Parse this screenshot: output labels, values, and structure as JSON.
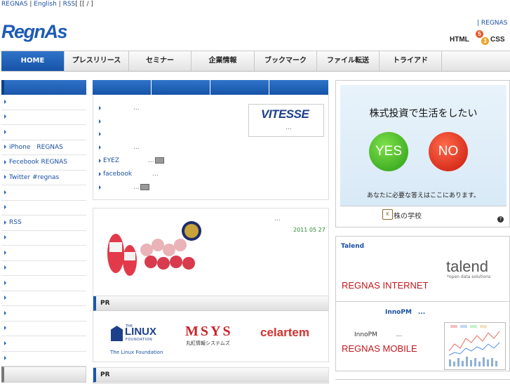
{
  "topbar": {
    "regnas": "REGNAS",
    "english": "English",
    "rss": "RSS",
    "tail": "[    [[     /  ]"
  },
  "logo": {
    "text": "RegnAs"
  },
  "header_right": {
    "link": "| REGNAS",
    "badge_left": "HTML",
    "badge_right": "CSS",
    "badge_5": "5",
    "badge_3": "3"
  },
  "nav": {
    "items": [
      "HOME",
      "プレスリリース",
      "セミナー",
      "企業情報",
      "ブックマーク",
      "ファイル転送",
      "トライアド"
    ]
  },
  "left_list": {
    "items": [
      "",
      "",
      "",
      "iPhone　REGNAS",
      "Fecebook REGNAS",
      "Twitter #regnas",
      "",
      "",
      "RSS",
      "",
      "",
      "",
      "",
      "",
      "",
      "",
      "",
      ""
    ]
  },
  "news": {
    "items": [
      {
        "text": "",
        "dots": "..."
      },
      {
        "text": "",
        "dots": ""
      },
      {
        "text": "",
        "dots": ""
      },
      {
        "text": "",
        "dots": "..."
      },
      {
        "text": "EYEZ",
        "dots": "..."
      },
      {
        "text": "facebook",
        "dots": "..."
      },
      {
        "text": "",
        "dots": "..."
      }
    ],
    "vitesse": {
      "logo": "VITESSE",
      "dots": "..."
    }
  },
  "featured": {
    "dots": "...",
    "date": "2011 05 27"
  },
  "pr": {
    "header": "PR",
    "linux_the": "THE",
    "linux_name": "LINUX",
    "linux_foundation": "FOUNDATION",
    "linux_caption": "The Linux Foundation",
    "msys": "MSYS",
    "msys_sub": "丸紅情報システムズ",
    "celartem": "celartem"
  },
  "pr2": {
    "header": "PR"
  },
  "ad": {
    "title": "株式投資で生活をしたい",
    "yes": "YES",
    "no": "NO",
    "sub": "あなたに必要な答えはここにあります。",
    "school": "株の学校",
    "school_icon": "K",
    "qmark": "?"
  },
  "talend": {
    "header": "Talend",
    "logo": "talend",
    "logo_sub": "*open data solutions",
    "big": "REGNAS INTERNET"
  },
  "inno": {
    "header": "InnoPM　...",
    "small": "InnoPM　　　...",
    "big": "REGNAS MOBILE"
  },
  "colors": {
    "brand_blue": "#1d5bb5",
    "nav_active": "#1653a8",
    "accent_red": "#c1171d",
    "date_green": "#2a8a2a"
  }
}
